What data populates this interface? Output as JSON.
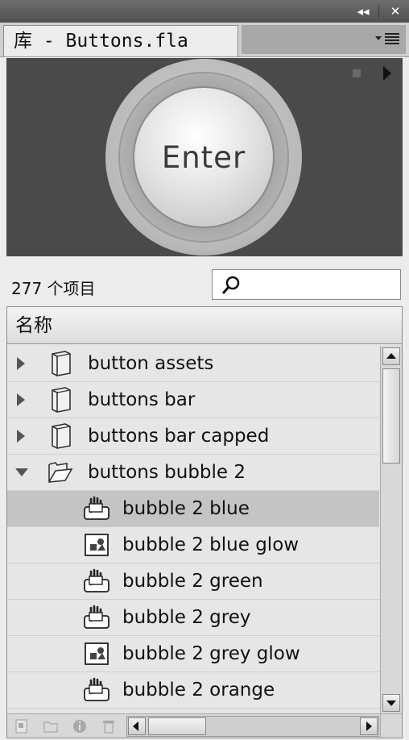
{
  "window": {
    "title": "库 - Buttons.fla",
    "collapse_icon": "double-chevron-left-icon",
    "close_icon": "close-icon",
    "menu_icon": "panel-menu-icon"
  },
  "preview": {
    "button_label": "Enter",
    "stop_icon": "stop-icon",
    "play_icon": "play-icon"
  },
  "library": {
    "item_count": "277 个项目",
    "search": {
      "value": "",
      "placeholder": ""
    },
    "column_header": "名称",
    "items": [
      {
        "label": "button assets",
        "type": "folder",
        "expander": "closed",
        "icon": "folder-icon"
      },
      {
        "label": "buttons bar",
        "type": "folder",
        "expander": "closed",
        "icon": "folder-icon"
      },
      {
        "label": "buttons bar capped",
        "type": "folder",
        "expander": "closed",
        "icon": "folder-icon"
      },
      {
        "label": "buttons bubble 2",
        "type": "folder",
        "expander": "open",
        "icon": "folder-open-icon"
      },
      {
        "label": "bubble 2 blue",
        "type": "button",
        "selected": true,
        "icon": "button-symbol-icon"
      },
      {
        "label": "bubble 2 blue glow",
        "type": "graphic",
        "icon": "graphic-symbol-icon"
      },
      {
        "label": "bubble 2 green",
        "type": "button",
        "icon": "button-symbol-icon"
      },
      {
        "label": "bubble 2 grey",
        "type": "button",
        "icon": "button-symbol-icon"
      },
      {
        "label": "bubble 2 grey glow",
        "type": "graphic",
        "icon": "graphic-symbol-icon"
      },
      {
        "label": "bubble 2 orange",
        "type": "button",
        "icon": "button-symbol-icon"
      }
    ]
  },
  "bottom_toolbar": {
    "icons": [
      "new-symbol-icon",
      "new-folder-icon",
      "properties-icon",
      "delete-icon"
    ]
  },
  "colors": {
    "preview_bg": "#4a4a4a",
    "selected_row": "#c4c4c4",
    "panel_bg": "#ececec"
  }
}
